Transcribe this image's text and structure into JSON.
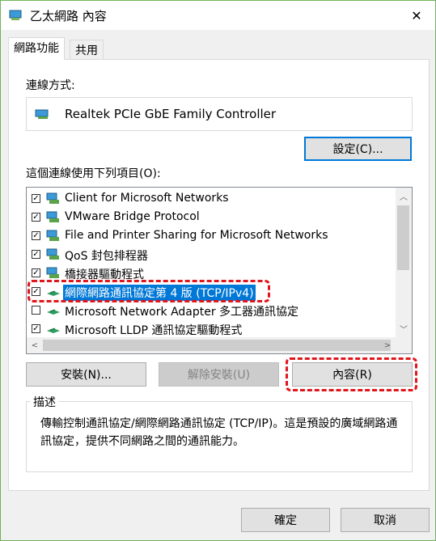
{
  "window": {
    "title": "乙太網路 內容"
  },
  "tabs": [
    {
      "label": "網路功能",
      "active": true
    },
    {
      "label": "共用",
      "active": false
    }
  ],
  "connection": {
    "label": "連線方式:",
    "adapter": "Realtek PCIe GbE Family Controller",
    "configure_button": "設定(C)..."
  },
  "items_label": "這個連線使用下列項目(O):",
  "items": [
    {
      "label": "Client for Microsoft Networks",
      "checked": true,
      "icon": "network-client-icon"
    },
    {
      "label": "VMware Bridge Protocol",
      "checked": true,
      "icon": "network-service-icon"
    },
    {
      "label": "File and Printer Sharing for Microsoft Networks",
      "checked": true,
      "icon": "network-service-icon"
    },
    {
      "label": "QoS 封包排程器",
      "checked": true,
      "icon": "network-service-icon"
    },
    {
      "label": "橋接器驅動程式",
      "checked": true,
      "icon": "network-service-icon"
    },
    {
      "label": "網際網路通訊協定第 4 版 (TCP/IPv4)",
      "checked": true,
      "selected": true,
      "icon": "protocol-icon"
    },
    {
      "label": "Microsoft Network Adapter 多工器通訊協定",
      "checked": false,
      "icon": "protocol-icon"
    },
    {
      "label": "Microsoft LLDP 通訊協定驅動程式",
      "checked": true,
      "icon": "protocol-icon"
    }
  ],
  "buttons": {
    "install": "安裝(N)...",
    "uninstall": "解除安裝(U)",
    "properties": "內容(R)",
    "ok": "確定",
    "cancel": "取消"
  },
  "description": {
    "title": "描述",
    "text": "傳輸控制通訊協定/網際網路通訊協定 (TCP/IP)。這是預設的廣域網路通訊協定，提供不同網路之間的通訊能力。"
  },
  "colors": {
    "selection": "#0078d7",
    "highlight": "#e0161c",
    "window_border": "#6fb25a"
  }
}
